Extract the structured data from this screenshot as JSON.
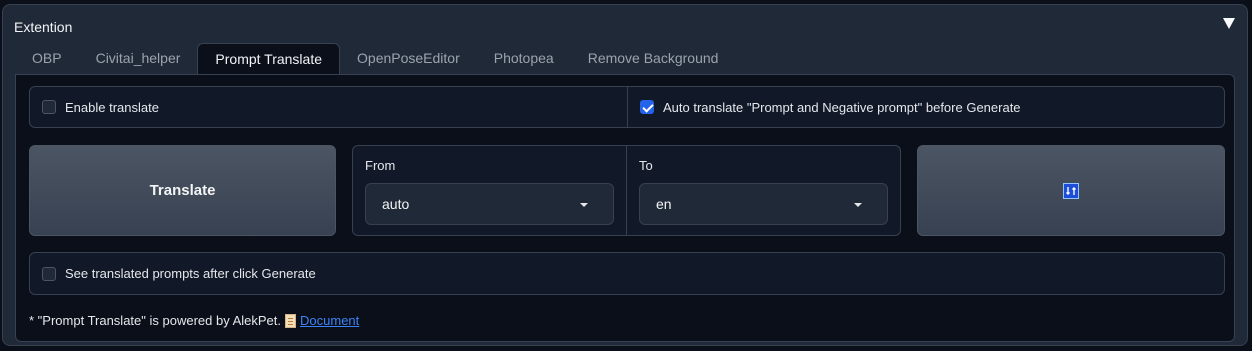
{
  "panel": {
    "title": "Extention",
    "collapse_icon": "triangle-down-icon"
  },
  "tabs": [
    {
      "label": "OBP",
      "active": false
    },
    {
      "label": "Civitai_helper",
      "active": false
    },
    {
      "label": "Prompt Translate",
      "active": true
    },
    {
      "label": "OpenPoseEditor",
      "active": false
    },
    {
      "label": "Photopea",
      "active": false
    },
    {
      "label": "Remove Background",
      "active": false
    }
  ],
  "options": {
    "enable_translate": {
      "label": "Enable translate",
      "checked": false
    },
    "auto_translate": {
      "label": "Auto translate \"Prompt and Negative prompt\" before Generate",
      "checked": true
    },
    "see_translated": {
      "label": "See translated prompts after click Generate",
      "checked": false
    }
  },
  "translate_button": {
    "label": "Translate"
  },
  "swap_button": {
    "icon": "swap-arrows-icon"
  },
  "languages": {
    "from": {
      "label": "From",
      "value": "auto"
    },
    "to": {
      "label": "To",
      "value": "en"
    }
  },
  "footer": {
    "text": "* \"Prompt Translate\" is powered by AlekPet.",
    "link_text": "Document",
    "icon": "scroll-icon"
  },
  "colors": {
    "background": "#0b0f19",
    "panel": "#1f2937",
    "accent": "#2563eb",
    "link": "#3b82f6"
  }
}
